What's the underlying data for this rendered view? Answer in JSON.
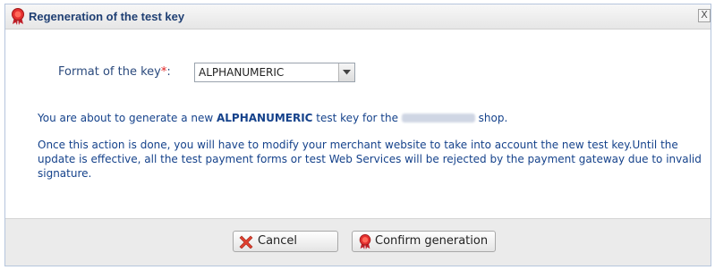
{
  "dialog": {
    "title": "Regeneration of the test key",
    "close_symbol": "X",
    "title_icon": "ribbon-icon"
  },
  "form": {
    "label": "Format of the key",
    "required_mark": "*",
    "colon": ":",
    "selected_value": "ALPHANUMERIC"
  },
  "message": {
    "line1_prefix": "You are about to generate a new ",
    "line1_key": "ALPHANUMERIC",
    "line1_middle": " test key for the ",
    "line1_suffix": " shop.",
    "paragraph2": "Once this action is done, you will have to modify your merchant website to take into account the new test key.Until the update is effective, all the test payment forms or test Web Services will be rejected by the payment gateway due to invalid signature."
  },
  "buttons": {
    "cancel": "Cancel",
    "confirm": "Confirm generation"
  },
  "colors": {
    "accent": "#15428b",
    "required": "#e02020"
  }
}
